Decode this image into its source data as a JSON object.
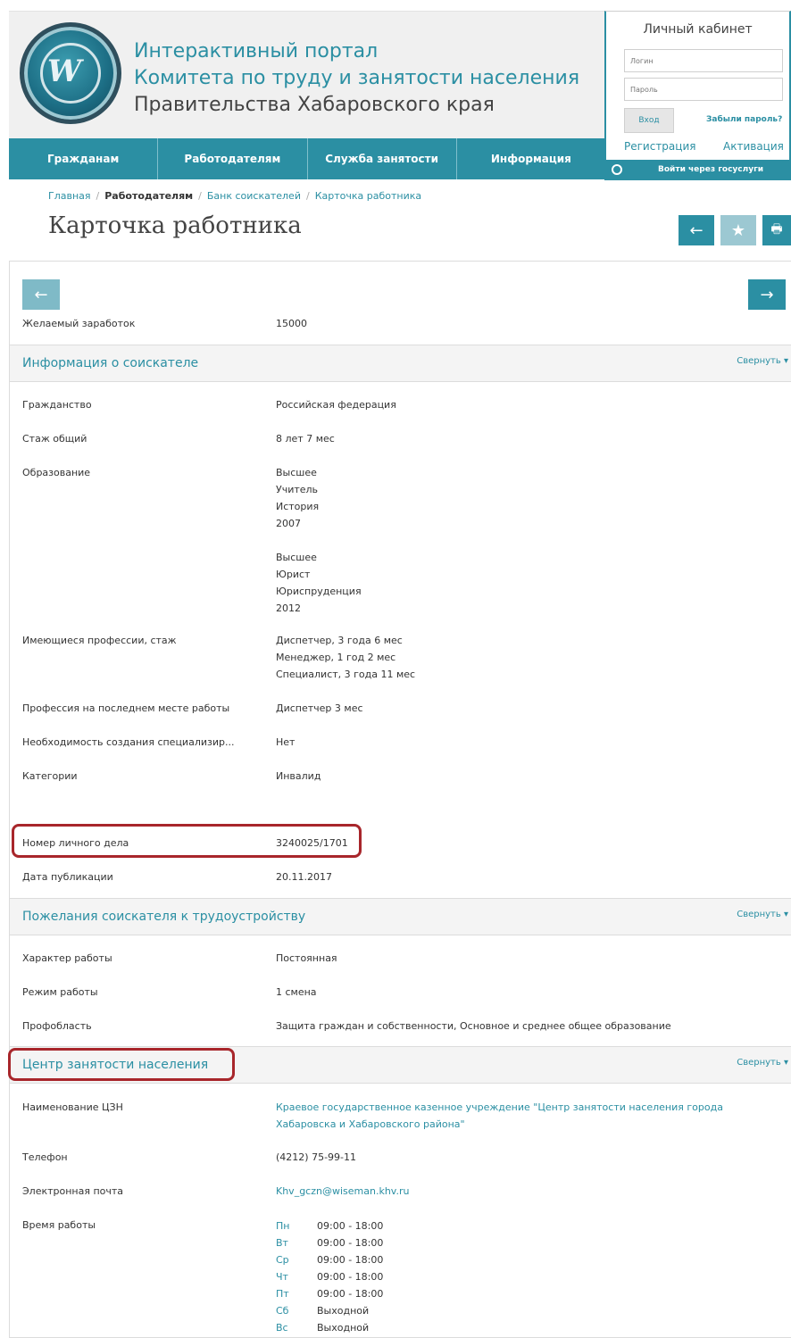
{
  "header": {
    "title_line1": "Интерактивный портал",
    "title_line2": "Комитета по труду и занятости населения",
    "title_line3": "Правительства Хабаровского края"
  },
  "nav": [
    "Гражданам",
    "Работодателям",
    "Служба занятости",
    "Информация"
  ],
  "cabinet": {
    "title": "Личный кабинет",
    "login_placeholder": "Логин",
    "password_placeholder": "Пароль",
    "login_button": "Вход",
    "forgot": "Забыли пароль?",
    "register": "Регистрация",
    "activate": "Активация",
    "gosuslugi": "Войти через госуслуги"
  },
  "breadcrumb": [
    "Главная",
    "Работодателям",
    "Банк соискателей",
    "Карточка работника"
  ],
  "page_title": "Карточка работника",
  "toolbar": {
    "back_icon": "←",
    "fav_icon": "★",
    "print_icon": "🖶"
  },
  "card": {
    "prev_icon": "←",
    "next_icon": "→",
    "salary": {
      "label": "Желаемый заработок",
      "value": "15000"
    },
    "section1": {
      "title": "Информация о соискателе",
      "collapse": "Свернуть",
      "rows": [
        {
          "label": "Гражданство",
          "value": [
            "Российская федерация"
          ]
        },
        {
          "label": "Стаж общий",
          "value": [
            "8 лет 7 мес"
          ]
        },
        {
          "label": "Образование",
          "value": [
            "Высшее",
            "Учитель",
            "История",
            "2007",
            "",
            "Высшее",
            "Юрист",
            "Юриспруденция",
            "2012"
          ]
        },
        {
          "label": "Имеющиеся профессии, стаж",
          "value": [
            "Диспетчер, 3 года 6 мес",
            "Менеджер, 1 год 2 мес",
            "Специалист, 3 года 11 мес"
          ]
        },
        {
          "label": "Профессия на последнем месте работы",
          "value": [
            "Диспетчер 3 мес"
          ]
        },
        {
          "label": "Необходимость создания специализир...",
          "value": [
            "Нет"
          ]
        },
        {
          "label": "Категории",
          "value": [
            "Инвалид"
          ]
        },
        {
          "label": "Номер личного дела",
          "value": [
            "3240025/1701"
          ]
        },
        {
          "label": "Дата публикации",
          "value": [
            "20.11.2017"
          ]
        }
      ]
    },
    "section2": {
      "title": "Пожелания соискателя к трудоустройству",
      "collapse": "Свернуть",
      "rows": [
        {
          "label": "Характер работы",
          "value": [
            "Постоянная"
          ]
        },
        {
          "label": "Режим работы",
          "value": [
            "1 смена"
          ]
        },
        {
          "label": "Профобласть",
          "value": [
            "Защита граждан и собственности, Основное и среднее общее образование"
          ]
        }
      ]
    },
    "section3": {
      "title": "Центр занятости населения",
      "collapse": "Свернуть",
      "rows": [
        {
          "label": "Наименование ЦЗН",
          "value": [
            "Краевое государственное казенное учреждение \"Центр занятости населения города",
            "Хабаровска и Хабаровского района\""
          ]
        },
        {
          "label": "Телефон",
          "value": [
            "(4212) 75-99-11"
          ]
        },
        {
          "label": "Электронная почта",
          "value": [
            "Khv_gczn@wiseman.khv.ru"
          ]
        },
        {
          "label": "Время работы",
          "value": []
        }
      ],
      "hours": [
        {
          "day": "Пн",
          "time": "09:00 - 18:00"
        },
        {
          "day": "Вт",
          "time": "09:00 - 18:00"
        },
        {
          "day": "Ср",
          "time": "09:00 - 18:00"
        },
        {
          "day": "Чт",
          "time": "09:00 - 18:00"
        },
        {
          "day": "Пт",
          "time": "09:00 - 18:00"
        },
        {
          "day": "Сб",
          "time": "Выходной"
        },
        {
          "day": "Вс",
          "time": "Выходной"
        }
      ]
    }
  }
}
